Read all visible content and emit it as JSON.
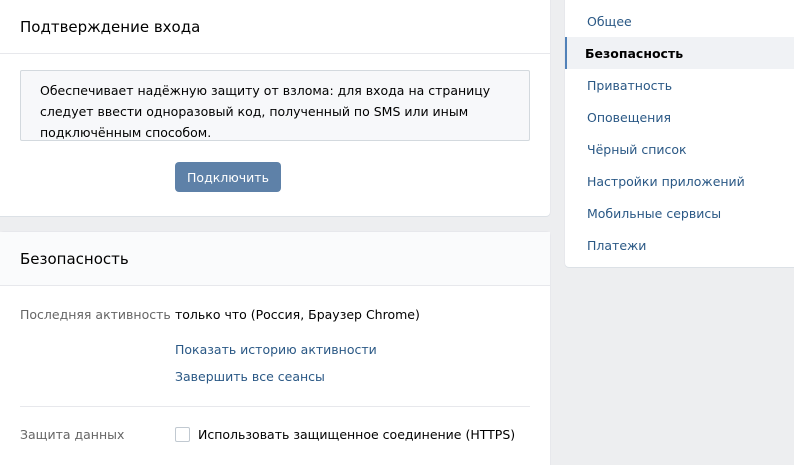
{
  "login_confirmation": {
    "title": "Подтверждение входа",
    "description": "Обеспечивает надёжную защиту от взлома: для входа на страницу следует ввести одноразовый код, полученный по SMS или иным подключённым способом.",
    "connect_button": "Подключить"
  },
  "security": {
    "title": "Безопасность",
    "last_activity_label": "Последняя активность",
    "last_activity_value": "только что (Россия, Браузер Chrome)",
    "show_history_link": "Показать историю активности",
    "end_sessions_link": "Завершить все сеансы",
    "data_protection_label": "Защита данных",
    "https_checkbox_label": "Использовать защищенное соединение (HTTPS)",
    "https_checked": false
  },
  "menu": {
    "items": [
      {
        "label": "Общее",
        "active": false
      },
      {
        "label": "Безопасность",
        "active": true
      },
      {
        "label": "Приватность",
        "active": false
      },
      {
        "label": "Оповещения",
        "active": false
      },
      {
        "label": "Чёрный список",
        "active": false
      },
      {
        "label": "Настройки приложений",
        "active": false
      },
      {
        "label": "Мобильные сервисы",
        "active": false
      },
      {
        "label": "Платежи",
        "active": false
      }
    ]
  },
  "colors": {
    "background": "#edeef0",
    "accent": "#5e81a8",
    "link": "#2a5885",
    "active_marker": "#5181b8"
  }
}
